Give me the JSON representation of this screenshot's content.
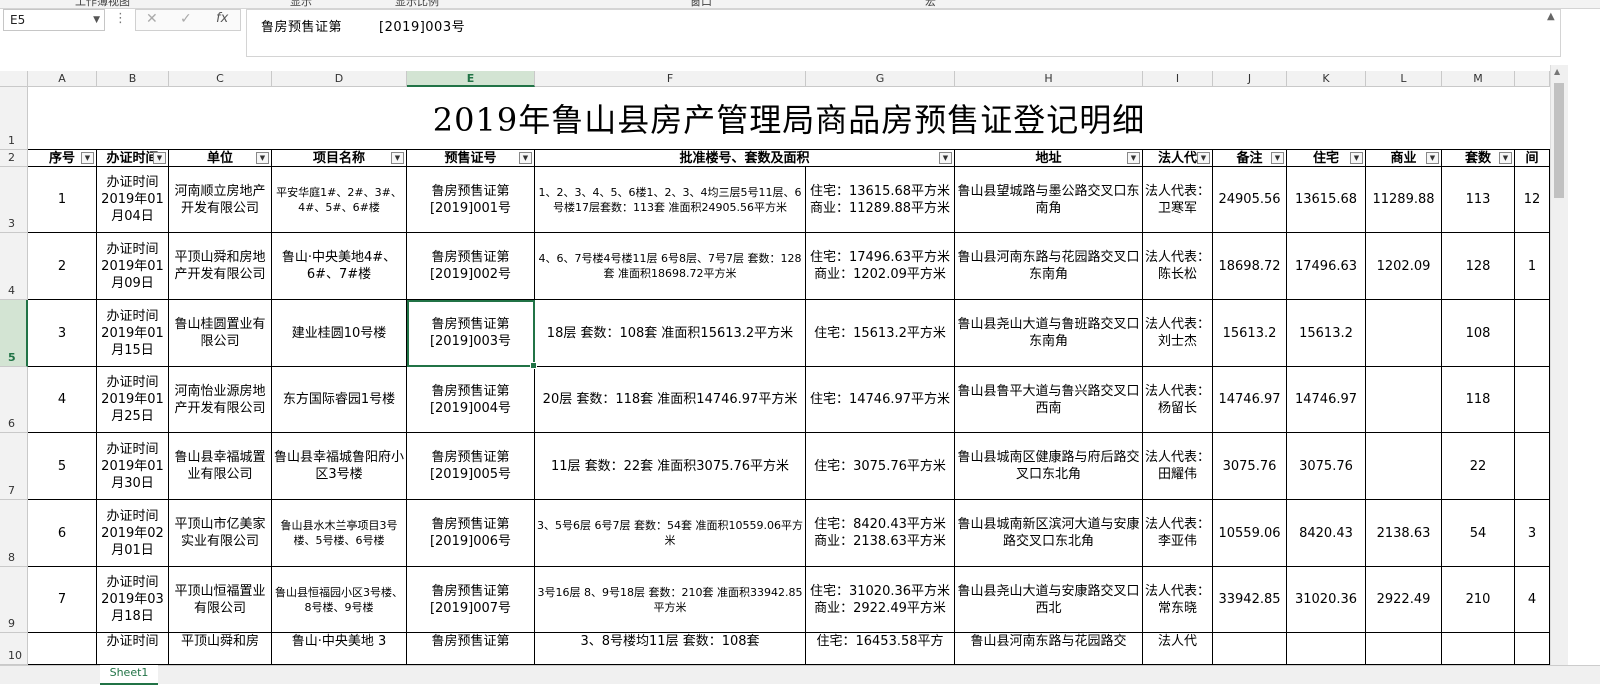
{
  "ribbon": {
    "tab_a": "工作簿视图",
    "tab_b": "显示",
    "tab_c": "显示比例",
    "tab_d": "窗口",
    "tab_e": "宏"
  },
  "formula_bar": {
    "name_box": "E5",
    "cancel_icon": "close-icon",
    "enter_icon": "check-icon",
    "fx_label": "fx",
    "content": "鲁房预售证第        [2019]003号"
  },
  "columns": [
    "A",
    "B",
    "C",
    "D",
    "E",
    "F",
    "G",
    "H",
    "I",
    "J",
    "K",
    "L",
    "M"
  ],
  "selected_column": "E",
  "selected_row": 5,
  "title": "2019年鲁山县房产管理局商品房预售证登记明细",
  "headers": [
    "序号",
    "办证时间",
    "单位",
    "项目名称",
    "预售证号",
    "批准楼号、套数及面积",
    "地址",
    "法人代",
    "备注",
    "住宅",
    "商业",
    "套数",
    "间"
  ],
  "rows": [
    {
      "row": 3,
      "no": "1",
      "date": "办证时间2019年01月04日",
      "unit": "河南顺立房地产开发有限公司",
      "project": "平安华庭1#、2#、3#、4#、5#、6#楼",
      "license": "鲁房预售证第[2019]001号",
      "approval": "1、2、3、4、5、6楼1、2、3、4均三层5号11层、6号楼17层套数：113套   准面积24905.56平方米",
      "area": "住宅：13615.68平方米   商业：11289.88平方米",
      "address": "鲁山县望城路与墨公路交叉口东南角",
      "legal": "法人代表：卫寒军",
      "note": "24905.56",
      "residential": "13615.68",
      "commercial": "11289.88",
      "sets": "113",
      "extra": "12"
    },
    {
      "row": 4,
      "no": "2",
      "date": "办证时间2019年01月09日",
      "unit": "平顶山舜和房地产开发有限公司",
      "project": "鲁山·中央美地4#、6#、7#楼",
      "license": "鲁房预售证第[2019]002号",
      "approval": "4、6、7号楼4号楼11层 6号8层、7号7层      套数：128套 准面积18698.72平方米",
      "area": "住宅：17496.63平方米   商业：1202.09平方米",
      "address": "鲁山县河南东路与花园路交叉口东南角",
      "legal": "法人代表：陈长松",
      "note": "18698.72",
      "residential": "17496.63",
      "commercial": "1202.09",
      "sets": "128",
      "extra": "1"
    },
    {
      "row": 5,
      "no": "3",
      "date": "办证时间2019年01月15日",
      "unit": "鲁山桂圆置业有限公司",
      "project": "建业桂圆10号楼",
      "license": "鲁房预售证第[2019]003号",
      "approval": "18层   套数：108套 准面积15613.2平方米",
      "area": "住宅：15613.2平方米",
      "address": "鲁山县尧山大道与鲁班路交叉口东南角",
      "legal": "法人代表：刘士杰",
      "note": "15613.2",
      "residential": "15613.2",
      "commercial": "",
      "sets": "108",
      "extra": ""
    },
    {
      "row": 6,
      "no": "4",
      "date": "办证时间2019年01月25日",
      "unit": "河南怡业源房地产开发有限公司",
      "project": "东方国际睿园1号楼",
      "license": "鲁房预售证第[2019]004号",
      "approval": "20层   套数：118套 准面积14746.97平方米",
      "area": "住宅：14746.97平方米",
      "address": "鲁山县鲁平大道与鲁兴路交叉口西南",
      "legal": "法人代表：杨留长",
      "note": "14746.97",
      "residential": "14746.97",
      "commercial": "",
      "sets": "118",
      "extra": ""
    },
    {
      "row": 7,
      "no": "5",
      "date": "办证时间2019年01月30日",
      "unit": "鲁山县幸福城置业有限公司",
      "project": "鲁山县幸福城鲁阳府小区3号楼",
      "license": "鲁房预售证第[2019]005号",
      "approval": "11层     套数：22套 准面积3075.76平方米",
      "area": "住宅：3075.76平方米",
      "address": "鲁山县城南区健康路与府后路交叉口东北角",
      "legal": "法人代表：田耀伟",
      "note": "3075.76",
      "residential": "3075.76",
      "commercial": "",
      "sets": "22",
      "extra": ""
    },
    {
      "row": 8,
      "no": "6",
      "date": "办证时间2019年02月01日",
      "unit": "平顶山市亿美家实业有限公司",
      "project": "鲁山县水木兰亭项目3号楼、5号楼、6号楼",
      "license": "鲁房预售证第[2019]006号",
      "approval": "3、5号6层 6号7层 套数：54套 准面积10559.06平方米",
      "area": "住宅：8420.43平方米 商业：2138.63平方米",
      "address": "鲁山县城南新区滨河大道与安康路交叉口东北角",
      "legal": "法人代表：李亚伟",
      "note": "10559.06",
      "residential": "8420.43",
      "commercial": "2138.63",
      "sets": "54",
      "extra": "3"
    },
    {
      "row": 9,
      "no": "7",
      "date": "办证时间2019年03月18日",
      "unit": "平顶山恒福置业有限公司",
      "project": "鲁山县恒福园小区3号楼、8号楼、9号楼",
      "license": "鲁房预售证第[2019]007号",
      "approval": "3号16层 8、9号18层 套数：210套 准面积33942.85平方米",
      "area": "住宅：31020.36平方米   商业：2922.49平方米",
      "address": "鲁山县尧山大道与安康路交叉口西北",
      "legal": "法人代表：常东晓",
      "note": "33942.85",
      "residential": "31020.36",
      "commercial": "2922.49",
      "sets": "210",
      "extra": "4"
    },
    {
      "row": 10,
      "no": "",
      "date": "办证时间",
      "unit": "平顶山舜和房",
      "project": "鲁山·中央美地 3",
      "license": "鲁房预售证第",
      "approval": "3、8号楼均11层      套数：108套",
      "area": "住宅：16453.58平方",
      "address": "鲁山县河南东路与花园路交",
      "legal": "法人代",
      "note": "",
      "residential": "",
      "commercial": "",
      "sets": "",
      "extra": ""
    }
  ],
  "sheet_tab": "Sheet1"
}
